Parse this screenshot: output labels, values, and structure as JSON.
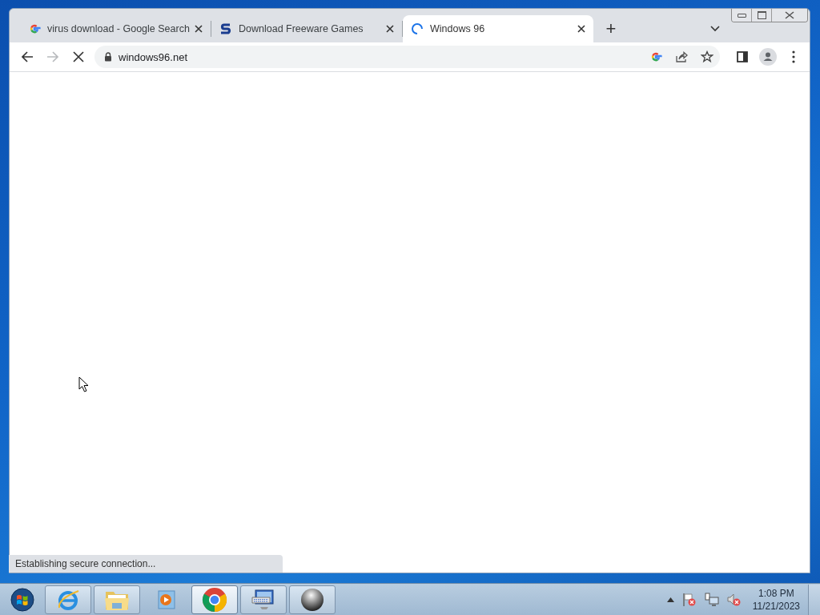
{
  "tabs": [
    {
      "title": "virus download - Google Search",
      "kind": "google",
      "selected": false
    },
    {
      "title": "Download Freeware Games",
      "kind": "s-logo",
      "selected": false
    },
    {
      "title": "Windows 96",
      "kind": "spinner",
      "selected": true
    }
  ],
  "new_tab": "+",
  "nav": {
    "back_enabled": true,
    "forward_enabled": false,
    "loading": true
  },
  "address_bar": {
    "url": "windows96.net"
  },
  "status_bubble": "Establishing secure connection...",
  "taskbar": {
    "items": [
      {
        "kind": "ie",
        "running": true,
        "active": false
      },
      {
        "kind": "explorer",
        "running": true,
        "active": false
      },
      {
        "kind": "media",
        "running": false,
        "active": false
      },
      {
        "kind": "chrome",
        "running": true,
        "active": true
      },
      {
        "kind": "keyboard",
        "running": true,
        "active": false
      },
      {
        "kind": "sphere",
        "running": true,
        "active": false
      }
    ]
  },
  "clock": {
    "time": "1:08 PM",
    "date": "11/21/2023"
  }
}
